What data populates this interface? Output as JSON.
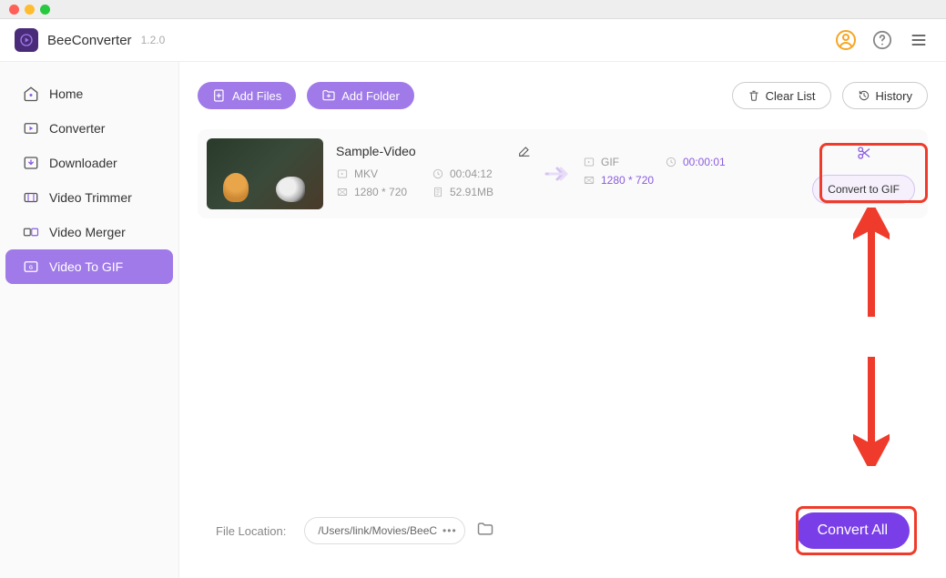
{
  "app": {
    "name": "BeeConverter",
    "version": "1.2.0"
  },
  "sidebar": {
    "items": [
      {
        "label": "Home"
      },
      {
        "label": "Converter"
      },
      {
        "label": "Downloader"
      },
      {
        "label": "Video Trimmer"
      },
      {
        "label": "Video Merger"
      },
      {
        "label": "Video To GIF"
      }
    ]
  },
  "toolbar": {
    "add_files": "Add Files",
    "add_folder": "Add Folder",
    "clear_list": "Clear List",
    "history": "History"
  },
  "file": {
    "title": "Sample-Video",
    "in_format": "MKV",
    "in_duration": "00:04:12",
    "in_resolution": "1280 * 720",
    "in_size": "52.91MB",
    "out_format": "GIF",
    "out_duration": "00:00:01",
    "out_resolution": "1280 * 720",
    "convert_label": "Convert to GIF"
  },
  "footer": {
    "label": "File Location:",
    "path": "/Users/link/Movies/BeeC",
    "convert_all": "Convert All"
  }
}
